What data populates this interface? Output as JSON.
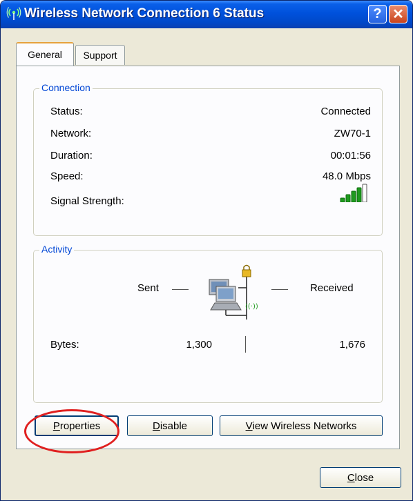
{
  "window": {
    "title": "Wireless Network Connection 6 Status"
  },
  "tabs": [
    {
      "label": "General"
    },
    {
      "label": "Support"
    }
  ],
  "connection": {
    "title": "Connection",
    "rows": [
      {
        "label": "Status:",
        "value": "Connected"
      },
      {
        "label": "Network:",
        "value": "ZW70-1"
      },
      {
        "label": "Duration:",
        "value": "00:01:56"
      },
      {
        "label": "Speed:",
        "value": "48.0 Mbps"
      }
    ],
    "signal_label": "Signal Strength:",
    "signal_bars": 4,
    "signal_bars_max": 5
  },
  "activity": {
    "title": "Activity",
    "sent_label": "Sent",
    "received_label": "Received",
    "bytes_label": "Bytes:",
    "bytes_sent": "1,300",
    "bytes_received": "1,676"
  },
  "buttons": {
    "properties": {
      "first": "P",
      "rest": "roperties"
    },
    "disable": {
      "first": "D",
      "rest": "isable"
    },
    "view_networks": {
      "first": "V",
      "rest": "iew Wireless Networks"
    },
    "close": {
      "first": "C",
      "rest": "lose"
    }
  },
  "colors": {
    "group_label": "#0046d5",
    "signal_bar": "#1e9a1e",
    "highlight_oval": "#e02020"
  },
  "icons": {
    "title": "wireless-icon",
    "help": "help-icon",
    "close": "close-icon",
    "network": "computers-network-icon",
    "lock": "lock-icon",
    "signal": "signal-strength-icon"
  }
}
